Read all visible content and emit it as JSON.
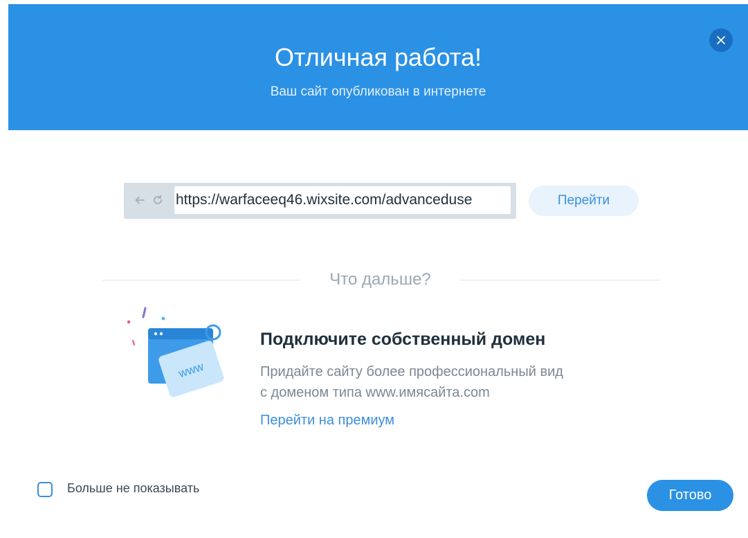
{
  "header": {
    "title": "Отличная работа!",
    "subtitle": "Ваш сайт опубликован в интернете",
    "close_icon": "close-icon"
  },
  "url_bar": {
    "back_icon": "arrow-left-icon",
    "refresh_icon": "refresh-icon",
    "url": "https://warfaceeq46.wixsite.com/advanceduse",
    "go_label": "Перейти"
  },
  "next_section": {
    "heading": "Что дальше?",
    "illustration_icon": "browser-www-tag-icon",
    "illustration_text": "www",
    "promo_title": "Подключите собственный домен",
    "promo_line1": "Придайте сайту более профессиональный вид",
    "promo_line2": "с доменом типа www.имясайта.com",
    "premium_link": "Перейти на премиум"
  },
  "footer": {
    "checkbox_label": "Больше не показывать",
    "checkbox_checked": false,
    "done_label": "Готово"
  },
  "colors": {
    "accent": "#2b91e5",
    "header_bg": "#2b91e5",
    "link": "#3b8fde",
    "title_text": "#20303c",
    "body_text": "#7a8894"
  }
}
